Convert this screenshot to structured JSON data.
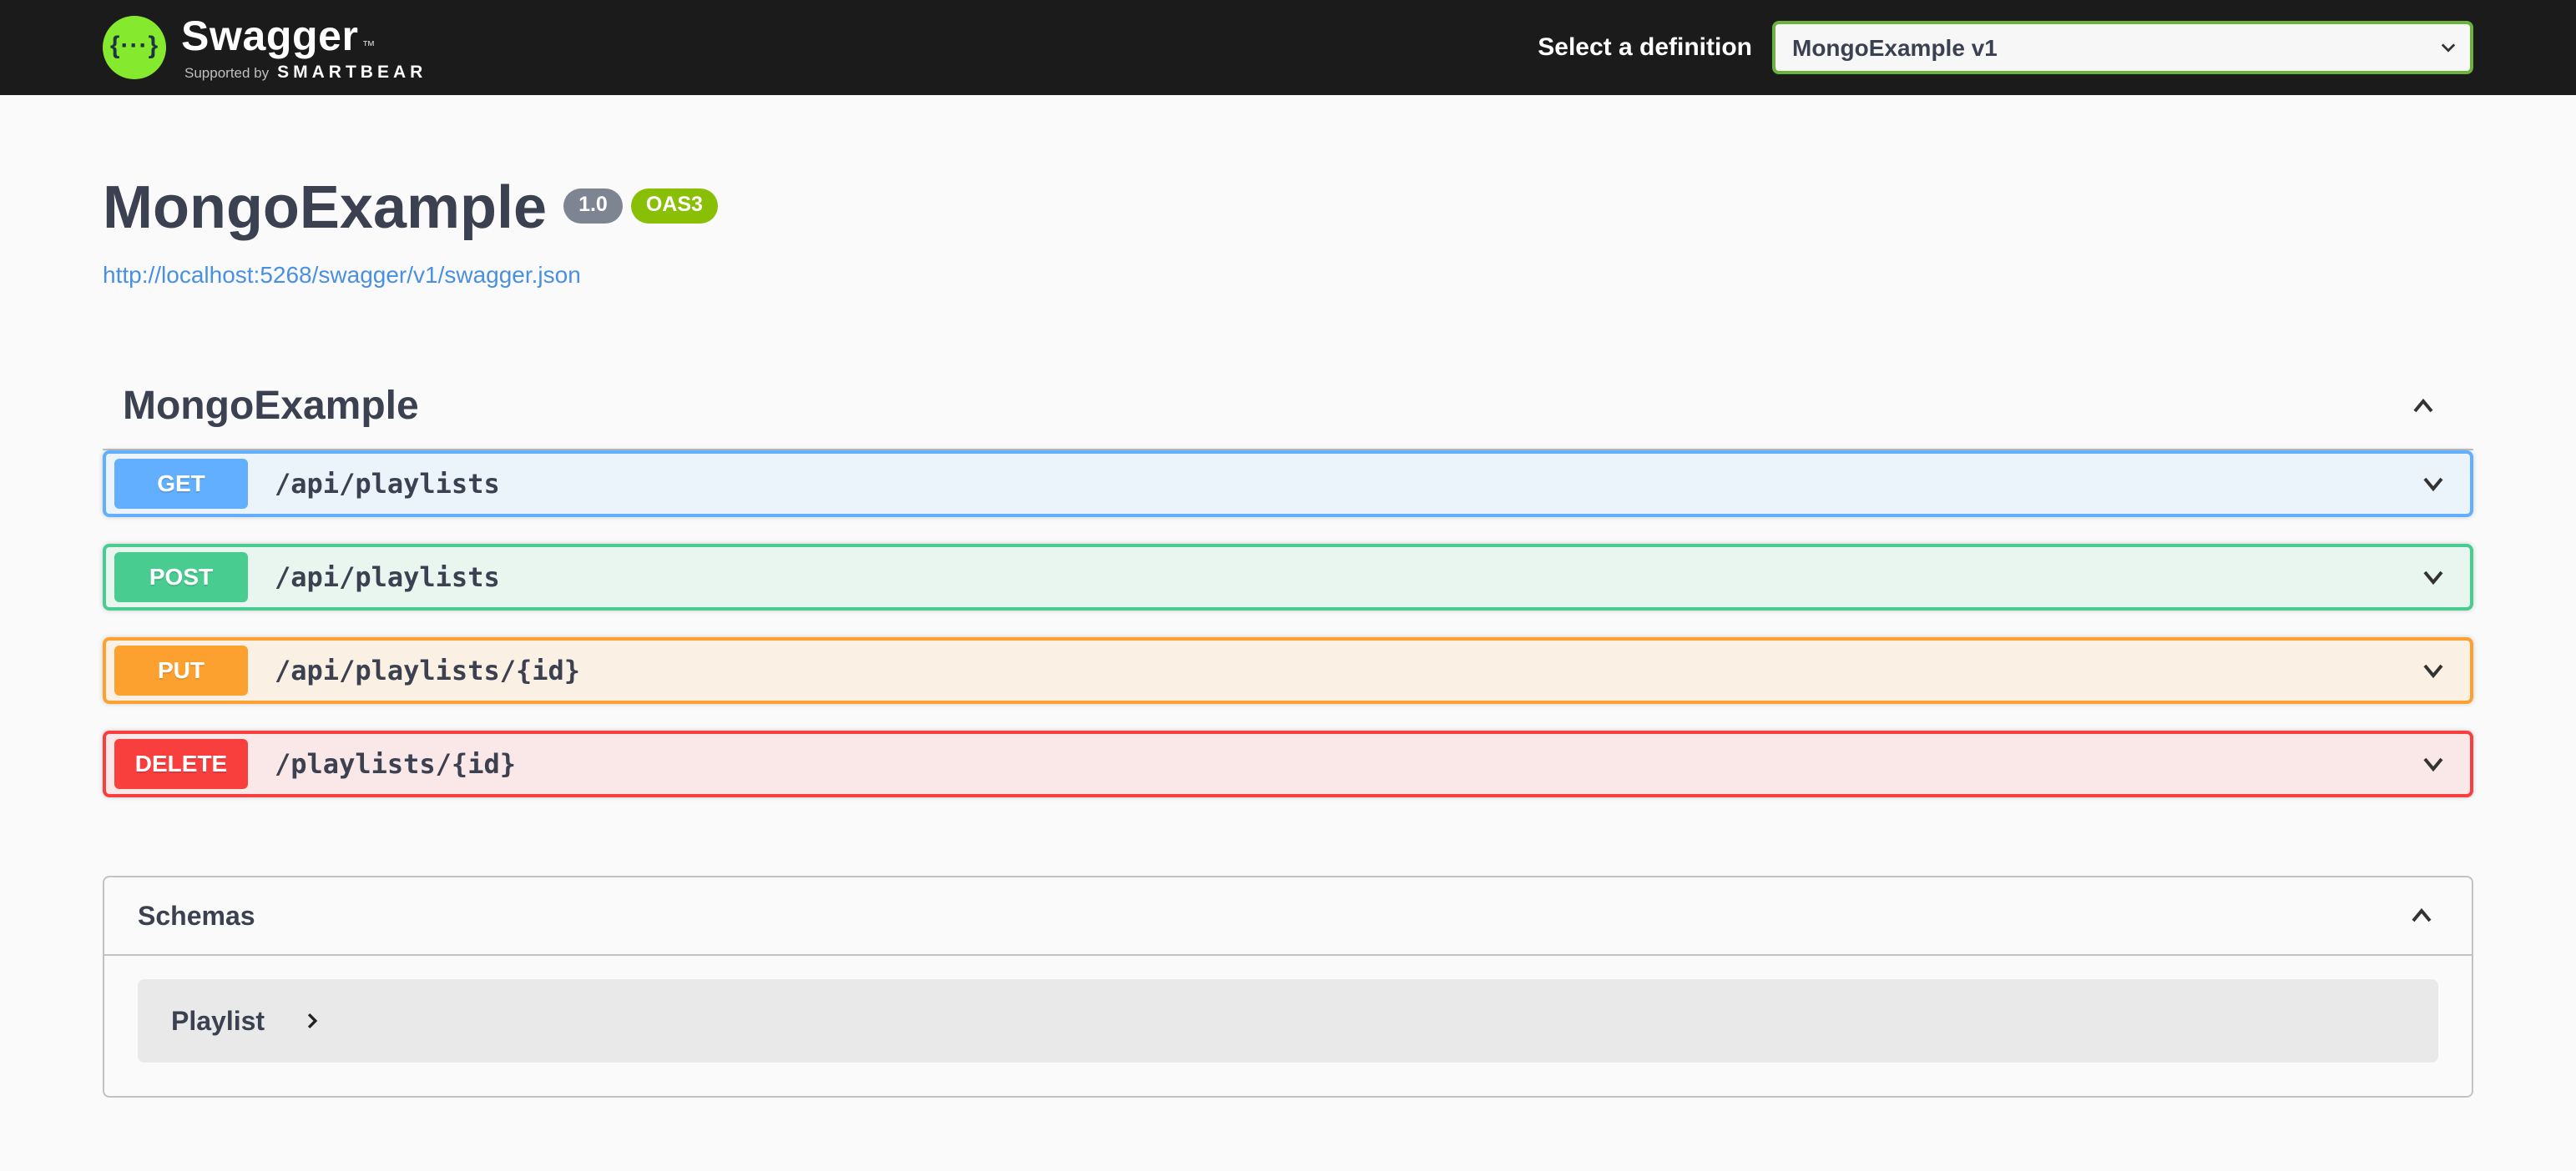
{
  "topbar": {
    "logo": {
      "brand": "Swagger",
      "trademark": "™",
      "glyph": "{···}",
      "tagline_prefix": "Supported by",
      "tagline_brand": "SMARTBEAR"
    },
    "definition_label": "Select a definition",
    "definition_selected": "MongoExample v1"
  },
  "info": {
    "title": "MongoExample",
    "version_badge": "1.0",
    "spec_badge": "OAS3",
    "spec_link": "http://localhost:5268/swagger/v1/swagger.json"
  },
  "tag_section": {
    "title": "MongoExample",
    "operations": [
      {
        "method": "GET",
        "path": "/api/playlists",
        "color": "#61affe",
        "background": "#ebf3fb"
      },
      {
        "method": "POST",
        "path": "/api/playlists",
        "color": "#49cc90",
        "background": "#e8f6ef"
      },
      {
        "method": "PUT",
        "path": "/api/playlists/{id}",
        "color": "#fca130",
        "background": "#fbf0e4"
      },
      {
        "method": "DELETE",
        "path": "/playlists/{id}",
        "color": "#f93e3e",
        "background": "#fae7e7"
      }
    ]
  },
  "schemas": {
    "title": "Schemas",
    "models": [
      {
        "name": "Playlist"
      }
    ]
  },
  "theme": {
    "topbar_background": "#1b1b1b",
    "page_background": "#fafafa",
    "heading_color": "#3b4151",
    "link_color": "#4990e2",
    "version_badge_color": "#7d8492",
    "spec_badge_color": "#89bf04",
    "select_border_color": "#6cb33e",
    "logo_green": "#85ea2d"
  }
}
